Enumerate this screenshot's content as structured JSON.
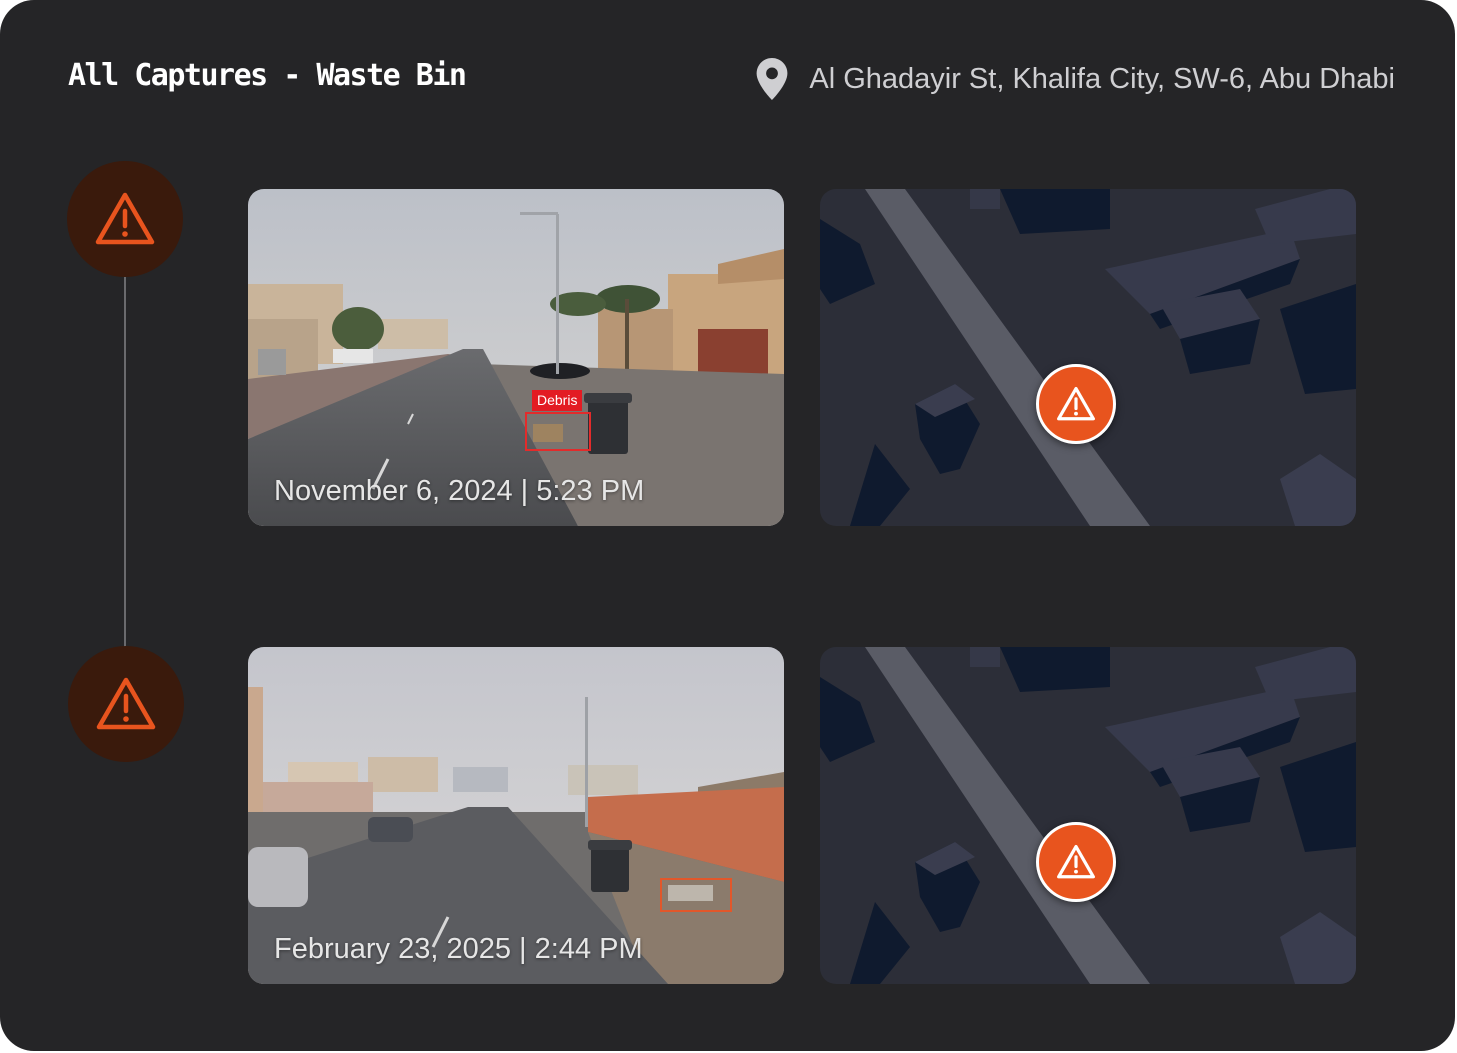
{
  "header": {
    "title": "All Captures - Waste Bin",
    "location": "Al Ghadayir St, Khalifa City, SW-6, Abu Dhabi",
    "location_icon": "location-pin-icon"
  },
  "captures": [
    {
      "timestamp": "November 6, 2024  |  5:23 PM",
      "detection_label": "Debris",
      "status_icon": "warning-icon"
    },
    {
      "timestamp": "February 23, 2025 | 2:44 PM",
      "status_icon": "warning-icon"
    }
  ],
  "colors": {
    "accent": "#E8541E",
    "panel": "#252527",
    "detection": "#E31B23"
  }
}
